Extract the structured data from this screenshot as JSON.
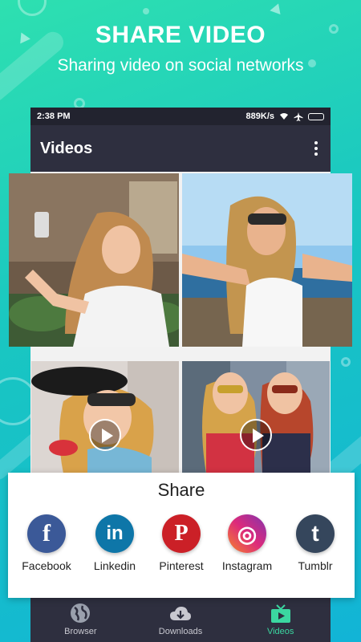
{
  "promo": {
    "title": "SHARE VIDEO",
    "subtitle": "Sharing video on social networks"
  },
  "statusbar": {
    "time": "2:38 PM",
    "speed": "889K/s"
  },
  "appbar": {
    "title": "Videos",
    "menu_icon": "more-vert-icon"
  },
  "videos": [
    {
      "description_icon": "video-thumbnail"
    },
    {
      "description_icon": "video-thumbnail"
    },
    {
      "description_icon": "video-thumbnail",
      "play": true
    },
    {
      "description_icon": "video-thumbnail",
      "play": true
    }
  ],
  "share": {
    "title": "Share",
    "items": [
      {
        "label": "Facebook",
        "glyph": "f",
        "color": "#3b5998",
        "icon": "facebook-icon"
      },
      {
        "label": "Linkedin",
        "glyph": "in",
        "color": "#0e76a8",
        "icon": "linkedin-icon"
      },
      {
        "label": "Pinterest",
        "glyph": "P",
        "color": "#cb2027",
        "icon": "pinterest-icon"
      },
      {
        "label": "Instagram",
        "glyph": "◎",
        "color": "#c13584",
        "icon": "instagram-icon"
      },
      {
        "label": "Tumblr",
        "glyph": "t",
        "color": "#35465c",
        "icon": "tumblr-icon"
      }
    ]
  },
  "bottom_nav": [
    {
      "label": "Browser",
      "icon": "globe-icon",
      "active": false
    },
    {
      "label": "Downloads",
      "icon": "cloud-download-icon",
      "active": false
    },
    {
      "label": "Videos",
      "icon": "tv-play-icon",
      "active": true
    }
  ],
  "colors": {
    "accent": "#3bd7a0",
    "appbar": "#2e2f3f",
    "statusbar": "#22232f"
  }
}
